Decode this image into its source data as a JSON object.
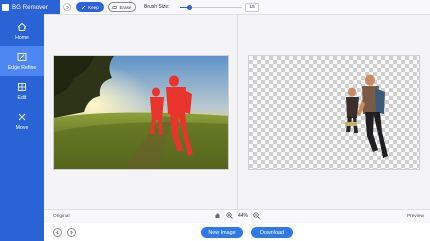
{
  "app": {
    "title": "BG Remover"
  },
  "sidebar": {
    "items": [
      {
        "label": "Home",
        "icon": "home-icon",
        "active": false
      },
      {
        "label": "Edge Refine",
        "icon": "edge-refine-icon",
        "active": true
      },
      {
        "label": "Edit",
        "icon": "edit-icon",
        "active": false
      },
      {
        "label": "Move",
        "icon": "move-icon",
        "active": false
      }
    ]
  },
  "toolbar": {
    "keep_label": "Keep",
    "erase_label": "Erase",
    "brush_size_label": "Brush Size:",
    "brush_size_value": "15",
    "brush_slider_fraction": 0.15
  },
  "status": {
    "original_label": "Original",
    "preview_label": "Preview",
    "zoom_value": "44%"
  },
  "actions": {
    "new_image_label": "New Image",
    "download_label": "Download"
  },
  "colors": {
    "brand_blue": "#2a63d6",
    "active_nav": "#4d86f0",
    "keep_mask_red": "#e8342a"
  }
}
